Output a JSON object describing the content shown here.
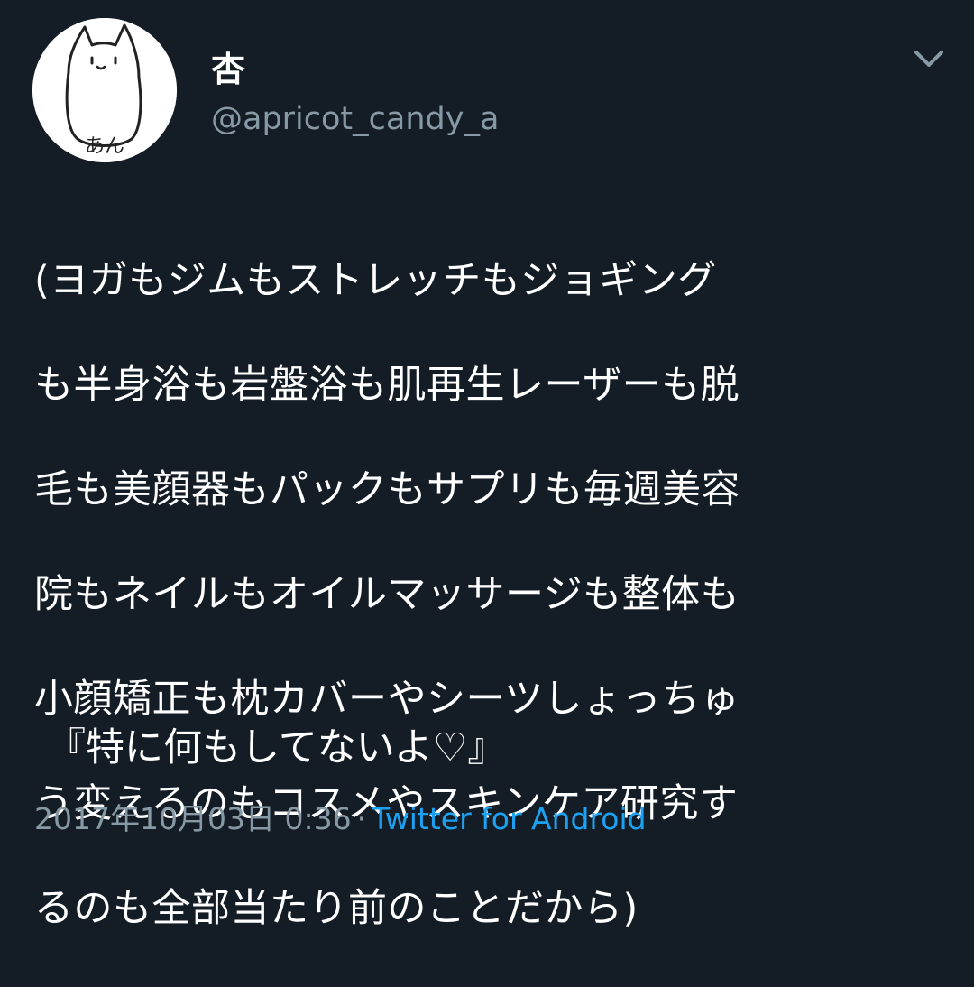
{
  "user": {
    "display_name": "杏",
    "handle": "@apricot_candy_a",
    "avatar_text": "あん"
  },
  "tweet": {
    "text_lines": [
      "(ヨガもジムもストレッチもジョギング",
      "も半身浴も岩盤浴も肌再生レーザーも脱",
      "毛も美顔器もパックもサプリも毎週美容",
      "院もネイルもオイルマッサージも整体も",
      "小顔矯正も枕カバーやシーツしょっちゅ",
      "う変えるのもコスメやスキンケア研究す",
      "るのも全部当たり前のことだから)"
    ],
    "quote": "『特に何もしてないよ♡』"
  },
  "meta": {
    "timestamp": "2017年10月03日 0:36",
    "separator": "·",
    "source": "Twitter for Android"
  },
  "icons": {
    "menu": "chevron-down-icon"
  },
  "colors": {
    "background": "#141d26",
    "text": "#ffffff",
    "secondary": "#8899a6",
    "link": "#1da1f2"
  }
}
